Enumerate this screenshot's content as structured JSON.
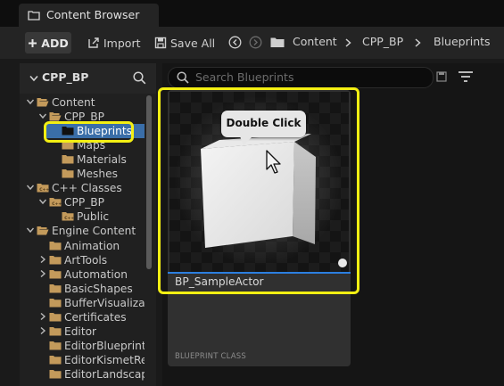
{
  "tab": {
    "title": "Content Browser"
  },
  "toolbar": {
    "add_label": "ADD",
    "import_label": "Import",
    "save_all_label": "Save All"
  },
  "breadcrumb": [
    "Content",
    "CPP_BP",
    "Blueprints"
  ],
  "sidebar": {
    "root_label": "CPP_BP"
  },
  "tree": [
    {
      "label": "Content"
    },
    {
      "label": "CPP_BP"
    },
    {
      "label": "Blueprints"
    },
    {
      "label": "Maps"
    },
    {
      "label": "Materials"
    },
    {
      "label": "Meshes"
    },
    {
      "label": "C++ Classes"
    },
    {
      "label": "CPP_BP"
    },
    {
      "label": "Public"
    },
    {
      "label": "Engine Content"
    },
    {
      "label": "Animation"
    },
    {
      "label": "ArtTools"
    },
    {
      "label": "Automation"
    },
    {
      "label": "BasicShapes"
    },
    {
      "label": "BufferVisualizat"
    },
    {
      "label": "Certificates"
    },
    {
      "label": "Editor"
    },
    {
      "label": "EditorBlueprintR"
    },
    {
      "label": "EditorKismetRes"
    },
    {
      "label": "EditorLandscape"
    }
  ],
  "search": {
    "placeholder": "Search Blueprints"
  },
  "asset": {
    "name": "BP_SampleActor",
    "class_label": "BLUEPRINT CLASS"
  },
  "tooltip": {
    "text": "Double Click"
  },
  "colors": {
    "highlight": "#f3ef13",
    "folder": "#c39a5b",
    "accent": "#2c7fe0"
  }
}
